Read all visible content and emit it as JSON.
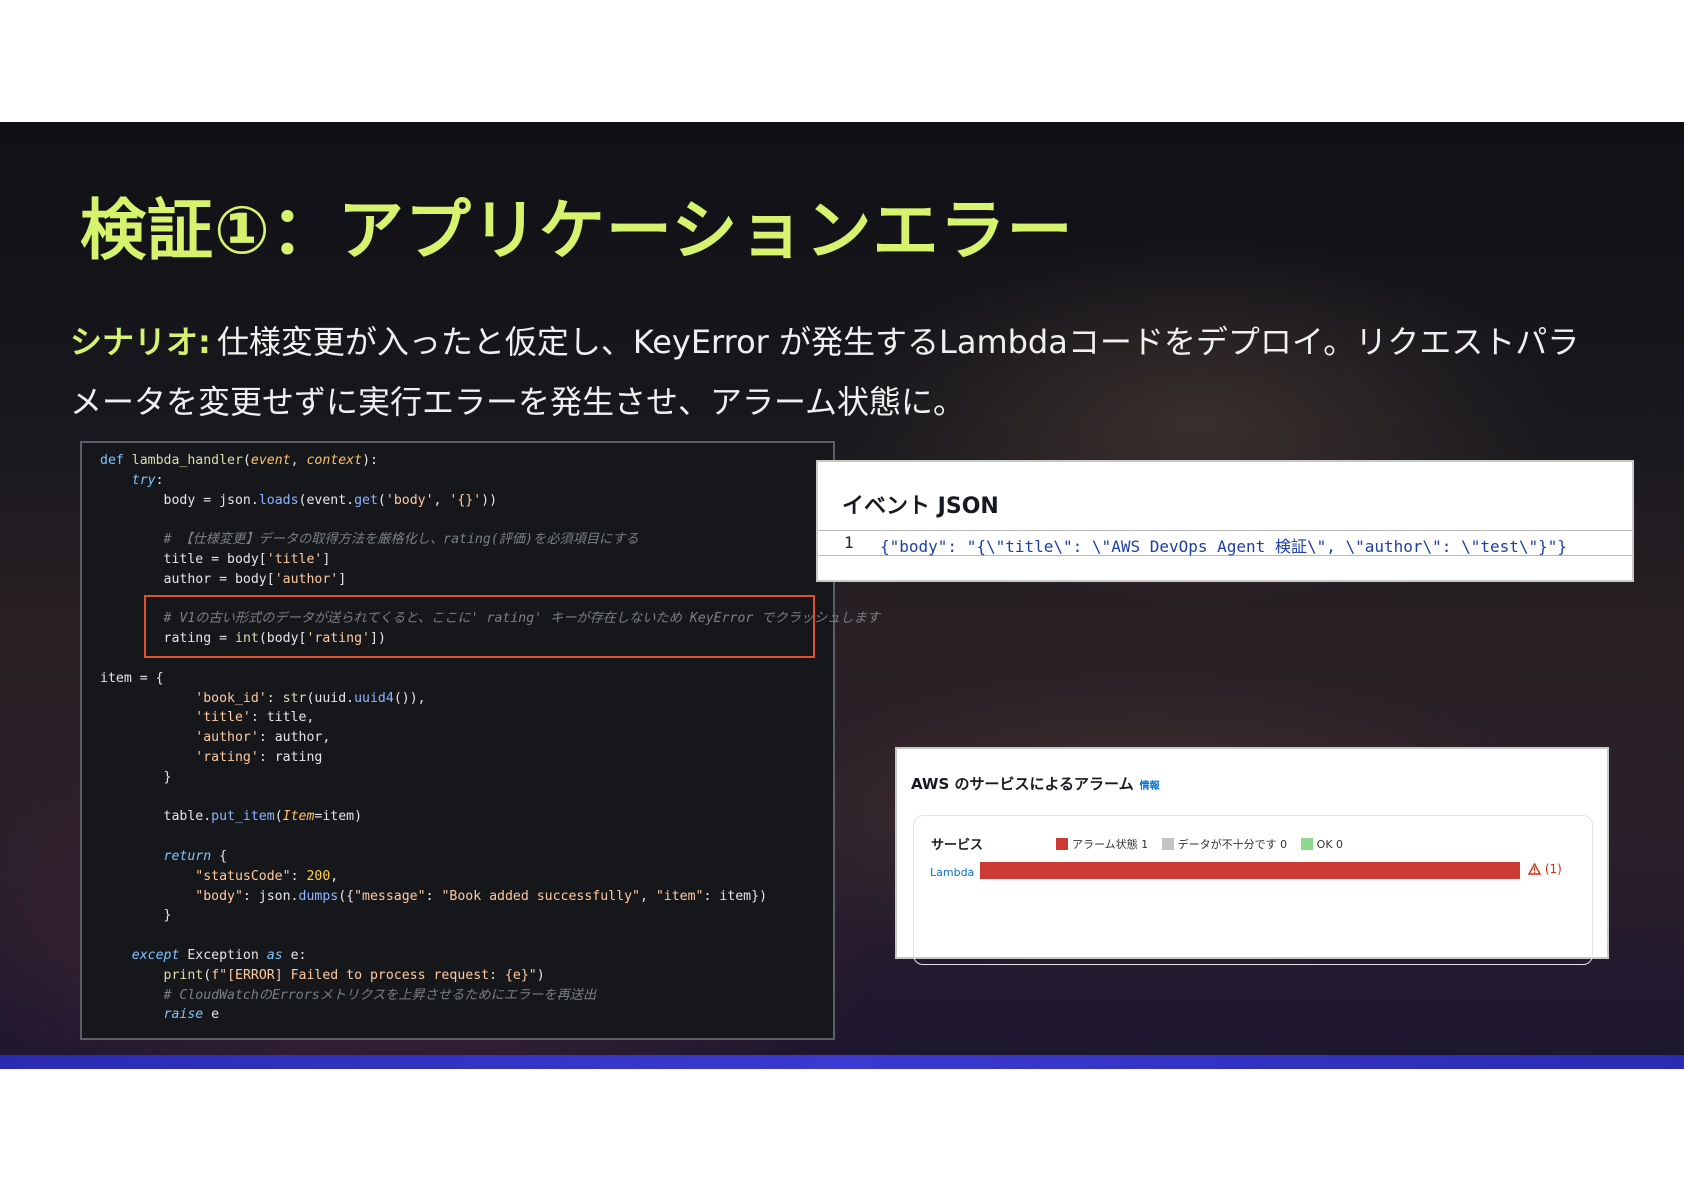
{
  "slide": {
    "title": "検証①：アプリケーションエラー",
    "scenario_label": "シナリオ:",
    "scenario_text": "仕様変更が入ったと仮定し、KeyError が発生するLambdaコードをデプロイ。リクエストパラメータを変更せずに実行エラーを発生させ、アラーム状態に。"
  },
  "code": {
    "line01_kw": "def",
    "line01_fn": "lambda_handler",
    "line01_p1": "event",
    "line01_p2": "context",
    "line02_kw": "try",
    "line03_a": "body = json.",
    "line03_m1": "loads",
    "line03_b": "(event.",
    "line03_m2": "get",
    "line03_s1": "'body'",
    "line03_s2": "'{}'",
    "line05_cm": "# 【仕様変更】データの取得方法を厳格化し、rating(評価)を必須項目にする",
    "line06_a": "title = body[",
    "line06_s": "'title'",
    "line07_a": "author = body[",
    "line07_s": "'author'",
    "line09_cm": "# V1の古い形式のデータが送られてくると、ここに' rating' キーが存在しないため KeyError でクラッシュします",
    "line10_a": "rating = ",
    "line10_fn": "int",
    "line10_b": "(body[",
    "line10_s": "'rating'",
    "line12": "item = {",
    "line13_s": "'book_id'",
    "line13_fn": "str",
    "line13_b": "(uuid.",
    "line13_m": "uuid4",
    "line14_s": "'title'",
    "line14_b": ": title,",
    "line15_s": "'author'",
    "line15_b": ": author,",
    "line16_s": "'rating'",
    "line16_b": ": rating",
    "line17": "}",
    "line19_a": "table.",
    "line19_m": "put_item",
    "line19_p": "Item",
    "line19_b": "=item)",
    "line21_kw": "return",
    "line22_s": "\"statusCode\"",
    "line22_n": "200",
    "line23_s1": "\"body\"",
    "line23_a": ": json.",
    "line23_m": "dumps",
    "line23_s2": "\"message\"",
    "line23_s3": "\"Book added successfully\"",
    "line23_s4": "\"item\"",
    "line23_b": ": item",
    "line24": "}",
    "line26_kw": "except",
    "line26_a": " Exception ",
    "line26_kw2": "as",
    "line26_b": " e:",
    "line27_fn": "print",
    "line27_s": "f\"[ERROR] Failed to process request: {e}\"",
    "line28_cm": "# CloudWatchのErrorsメトリクスを上昇させるためにエラーを再送出",
    "line29_kw": "raise",
    "line29_b": " e"
  },
  "event_json": {
    "title": "イベント JSON",
    "line_number": "1",
    "content": "{\"body\": \"{\\\"title\\\": \\\"AWS DevOps Agent 検証\\\", \\\"author\\\": \\\"test\\\"}\"}"
  },
  "alarm": {
    "heading": "AWS のサービスによるアラーム",
    "info_link": "情報",
    "service_label": "サービス",
    "legend": [
      {
        "label": "アラーム状態 1",
        "color": "#cc3b33"
      },
      {
        "label": "データが不十分です 0",
        "color": "#c4c4c4"
      },
      {
        "label": "OK 0",
        "color": "#8fd98f"
      }
    ],
    "row_label": "Lambda",
    "alarm_count": "(1)",
    "in_alarm": 1,
    "insufficient": 0,
    "ok": 0
  },
  "colors": {
    "accent": "#d6f36e",
    "highlight_box": "#e0502b",
    "alarm_bar": "#cc3b33"
  }
}
